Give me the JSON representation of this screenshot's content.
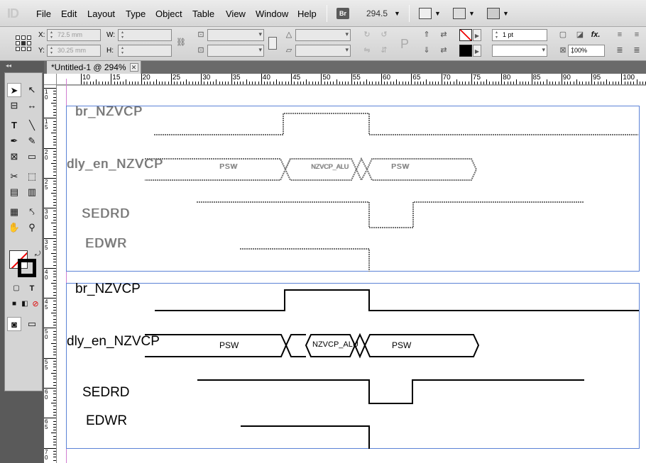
{
  "app": {
    "logo": "ID"
  },
  "menu": {
    "items": [
      {
        "label": "File",
        "key": "F"
      },
      {
        "label": "Edit",
        "key": "E"
      },
      {
        "label": "Layout",
        "key": "L"
      },
      {
        "label": "Type",
        "key": "T"
      },
      {
        "label": "Object",
        "key": "O"
      },
      {
        "label": "Table",
        "key": "a"
      },
      {
        "label": "View",
        "key": "V"
      },
      {
        "label": "Window",
        "key": "W"
      },
      {
        "label": "Help",
        "key": "H"
      }
    ],
    "bridge_label": "Br",
    "zoom": "294.5"
  },
  "control": {
    "x_label": "X:",
    "x_value": "72.5 mm",
    "y_label": "Y:",
    "y_value": "30.25 mm",
    "w_label": "W:",
    "h_label": "H:",
    "stroke_weight": "1 pt",
    "opacity": "100%",
    "fx_label": "fx."
  },
  "tab": {
    "title": "*Untitled-1 @ 294%"
  },
  "rulers": {
    "h": [
      "10",
      "15",
      "20",
      "25",
      "30",
      "35",
      "40",
      "45",
      "50",
      "55",
      "60",
      "65",
      "70",
      "75",
      "80",
      "85",
      "90",
      "95",
      "100",
      "105"
    ],
    "v": [
      "1",
      "1",
      "2",
      "2",
      "3",
      "3",
      "4",
      "4",
      "5",
      "5",
      "6",
      "6",
      "7"
    ],
    "v_sub": [
      "0",
      "5",
      "0",
      "5",
      "0",
      "5",
      "0",
      "5",
      "0",
      "5",
      "0",
      "5",
      "0"
    ]
  },
  "diagram_top": {
    "signals": [
      "br_NZVCP",
      "dly_en_NZVCP",
      "SEDRD",
      "EDWR"
    ],
    "bus_labels": [
      "PSW",
      "NZVCP_ALU",
      "PSW"
    ]
  },
  "diagram_bottom": {
    "signals": [
      "br_NZVCP",
      "dly_en_NZVCP",
      "SEDRD",
      "EDWR"
    ],
    "bus_labels": [
      "PSW",
      "NZVCP_ALU",
      "PSW"
    ]
  },
  "colors": {
    "frame_blue": "#5b82d6",
    "margin_magenta": "#d07dd0",
    "panel_dark": "#5a5a5a"
  }
}
